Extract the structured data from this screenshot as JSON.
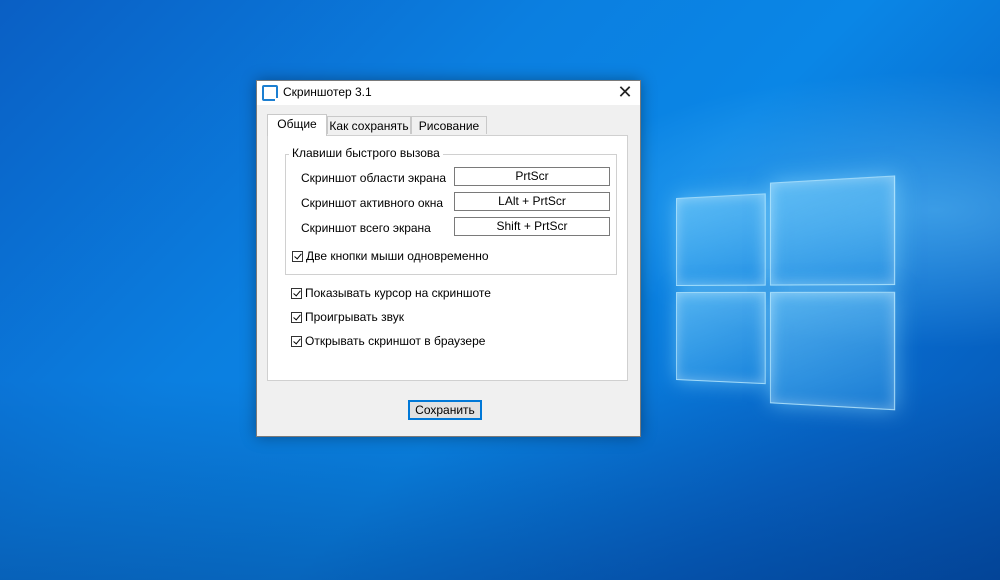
{
  "window": {
    "title": "Скриншотер 3.1",
    "close_symbol": "✕"
  },
  "tabs": [
    {
      "label": "Общие",
      "active": true
    },
    {
      "label": "Как сохранять",
      "active": false
    },
    {
      "label": "Рисование",
      "active": false
    }
  ],
  "hotkeys": {
    "group_title": "Клавиши быстрого вызова",
    "rows": [
      {
        "label": "Скриншот области экрана",
        "value": "PrtScr"
      },
      {
        "label": "Скриншот активного окна",
        "value": "LAlt + PrtScr"
      },
      {
        "label": "Скриншот всего экрана",
        "value": "Shift + PrtScr"
      }
    ],
    "both_mouse_buttons": {
      "label": "Две кнопки мыши одновременно",
      "checked": true
    }
  },
  "options": [
    {
      "label": "Показывать курсор на скриншоте",
      "checked": true
    },
    {
      "label": "Проигрывать звук",
      "checked": true
    },
    {
      "label": "Открывать скриншот в браузере",
      "checked": true
    }
  ],
  "save_button": "Сохранить",
  "colors": {
    "accent": "#0078d7",
    "desktop": "#0b7fe0"
  }
}
